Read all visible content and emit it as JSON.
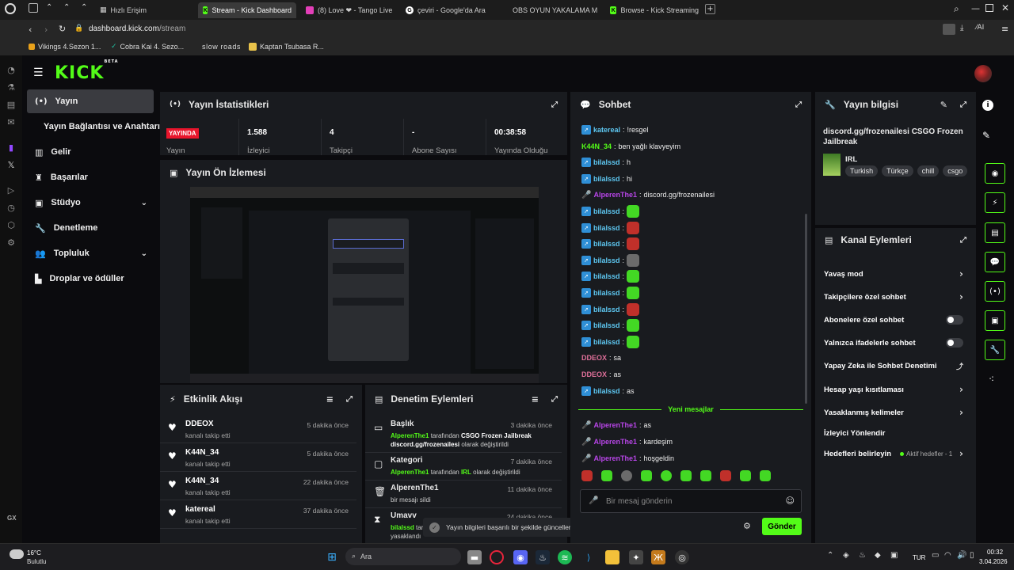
{
  "tabs": [
    {
      "label": "Hızlı Erişim",
      "icon": "grid-icon"
    },
    {
      "label": "Stream - Kick Dashboard",
      "active": true
    },
    {
      "label": "(8) Love ❤ - Tango Live"
    },
    {
      "label": "çeviri - Google'da Ara"
    },
    {
      "label": "OBS OYUN YAKALAMA M"
    },
    {
      "label": "Browse - Kick Streaming"
    }
  ],
  "address": {
    "host": "dashboard.kick.com",
    "path": "/stream"
  },
  "bookmarks": [
    "Vikings 4.Sezon 1...",
    "Cobra Kai 4. Sezo...",
    "slow roads",
    "Kaptan Tsubasa R..."
  ],
  "browser_label": "GX",
  "brand": {
    "logo": "KICK",
    "beta": "BETA",
    "accent": "#53fc18"
  },
  "nav": [
    {
      "label": "Yayın",
      "active": true
    },
    {
      "label": "Yayın Bağlantısı ve Anahtarı"
    },
    {
      "label": "Gelir"
    },
    {
      "label": "Başarılar"
    },
    {
      "label": "Stüdyo",
      "expandable": true
    },
    {
      "label": "Denetleme"
    },
    {
      "label": "Topluluk",
      "expandable": true
    },
    {
      "label": "Droplar ve ödüller"
    }
  ],
  "stats": {
    "title": "Yayın İstatistikleri",
    "live_badge": "YAYINDA",
    "live_label": "Yayın",
    "viewers": "1.588",
    "viewers_label": "İzleyici",
    "followers": "4",
    "followers_label": "Takipçi",
    "subs": "-",
    "subs_label": "Abone Sayısı",
    "uptime": "00:38:58",
    "uptime_label": "Yayında Olduğu"
  },
  "preview": {
    "title": "Yayın Ön İzlemesi"
  },
  "activity": {
    "title": "Etkinlik Akışı",
    "items": [
      {
        "name": "DDEOX",
        "sub": "kanalı takip etti",
        "time": "5 dakika önce"
      },
      {
        "name": "K44N_34",
        "sub": "kanalı takip etti",
        "time": "5 dakika önce"
      },
      {
        "name": "K44N_34",
        "sub": "kanalı takip etti",
        "time": "22 dakika önce"
      },
      {
        "name": "katereal",
        "sub": "kanalı takip etti",
        "time": "37 dakika önce"
      }
    ]
  },
  "modactions": {
    "title": "Denetim Eylemleri",
    "items": [
      {
        "title": "Başlık",
        "time": "3 dakika önce",
        "user": "AlperenThe1",
        "mid": " tarafından ",
        "value": "CSGO Frozen Jailbreak discord.gg/frozenailesi",
        "end": " olarak değiştirildi"
      },
      {
        "title": "Kategori",
        "time": "7 dakika önce",
        "user": "AlperenThe1",
        "mid": " tarafından ",
        "value": "IRL",
        "end": " olarak değiştirildi"
      },
      {
        "title": "AlperenThe1",
        "time": "11 dakika önce",
        "desc": "bir mesajı sildi"
      },
      {
        "title": "Umavv",
        "time": "24 dakika önce",
        "user": "bilalssd",
        "mid": " tarafından",
        "end": " yasaklandı"
      }
    ]
  },
  "toast": {
    "text": "Yayın bilgileri başarılı bir şekilde güncellendi."
  },
  "chat": {
    "title": "Sohbet",
    "messages": [
      {
        "user": "katereal",
        "text": "!resgel",
        "color": "#5ec8f2"
      },
      {
        "user": "K44N_34",
        "text": "ben yağlı klavyeyim",
        "color": "#53fc18"
      },
      {
        "user": "bilalssd",
        "text": "h",
        "color": "#5ec8f2"
      },
      {
        "user": "bilalssd",
        "text": "hi",
        "color": "#5ec8f2"
      },
      {
        "user": "AlperenThe1",
        "text": "discord.gg/frozenailesi",
        "color": "#b845e8"
      },
      {
        "user": "bilalssd",
        "emote": "em-g",
        "color": "#5ec8f2"
      },
      {
        "user": "bilalssd",
        "emote": "em-r",
        "color": "#5ec8f2"
      },
      {
        "user": "bilalssd",
        "emote": "em-r",
        "color": "#5ec8f2"
      },
      {
        "user": "bilalssd",
        "emote": "em-b",
        "color": "#5ec8f2"
      },
      {
        "user": "bilalssd",
        "emote": "em-g",
        "color": "#5ec8f2"
      },
      {
        "user": "bilalssd",
        "emote": "em-g",
        "color": "#5ec8f2"
      },
      {
        "user": "bilalssd",
        "emote": "em-r",
        "color": "#5ec8f2"
      },
      {
        "user": "bilalssd",
        "emote": "em-g",
        "color": "#5ec8f2"
      },
      {
        "user": "bilalssd",
        "emote": "em-g",
        "color": "#5ec8f2"
      },
      {
        "user": "DDEOX",
        "text": "sa",
        "color": "#e0709a"
      },
      {
        "user": "DDEOX",
        "text": "as",
        "color": "#e0709a"
      },
      {
        "user": "bilalssd",
        "text": "as",
        "color": "#5ec8f2"
      }
    ],
    "new_label": "Yeni mesajlar",
    "new_messages": [
      {
        "user": "AlperenThe1",
        "text": "as"
      },
      {
        "user": "AlperenThe1",
        "text": "kardeşim"
      },
      {
        "user": "AlperenThe1",
        "text": "hoşgeldin"
      }
    ],
    "placeholder": "Bir mesaj gönderin",
    "send": "Gönder"
  },
  "streaminfo": {
    "title": "Yayın bilgisi",
    "stream_title": "discord.gg/frozenailesi CSGO Frozen Jailbreak",
    "category": "IRL",
    "tags": [
      "Turkish",
      "Türkçe",
      "chill",
      "csgo"
    ]
  },
  "channel_actions": {
    "title": "Kanal Eylemleri",
    "items": [
      {
        "label": "Yavaş mod",
        "kind": "chev"
      },
      {
        "label": "Takipçilere özel sohbet",
        "kind": "chev"
      },
      {
        "label": "Abonelere özel sohbet",
        "kind": "toggle"
      },
      {
        "label": "Yalnızca ifadelerle sohbet",
        "kind": "toggle"
      },
      {
        "label": "Yapay Zeka ile Sohbet Denetimi",
        "kind": "ext"
      },
      {
        "label": "Hesap yaşı kısıtlaması",
        "kind": "chev"
      },
      {
        "label": "Yasaklanmış kelimeler",
        "kind": "chev"
      },
      {
        "label": "İzleyici Yönlendir",
        "kind": "none"
      },
      {
        "label": "Hedefleri belirleyin",
        "kind": "goal",
        "status": "Aktif hedefler - 1"
      }
    ]
  },
  "taskbar": {
    "weather_temp": "16°C",
    "weather_desc": "Bulutlu",
    "search": "Ara",
    "lang": "TUR",
    "time": "00:32",
    "date": "3.04.2026"
  }
}
